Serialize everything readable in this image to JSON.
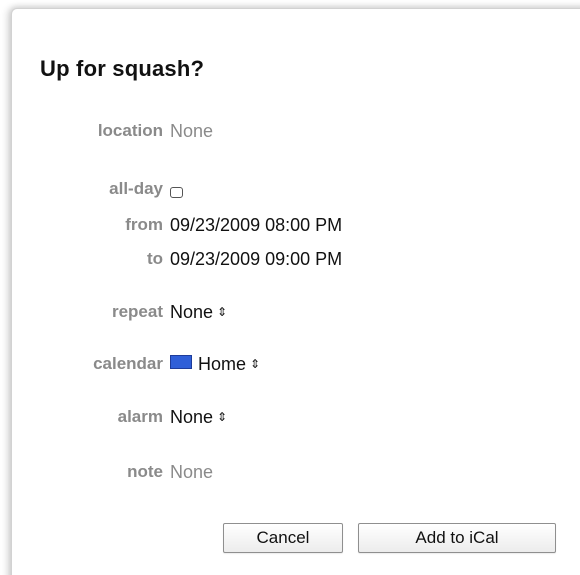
{
  "window": {
    "title": "Up for squash?"
  },
  "fields": {
    "location": {
      "label": "location",
      "value": "None"
    },
    "all_day": {
      "label": "all-day",
      "checked": false
    },
    "from": {
      "label": "from",
      "value": "09/23/2009 08:00 PM"
    },
    "to": {
      "label": "to",
      "value": "09/23/2009 09:00 PM"
    },
    "repeat": {
      "label": "repeat",
      "value": "None"
    },
    "calendar": {
      "label": "calendar",
      "value": "Home",
      "color": "#2f5fd8"
    },
    "alarm": {
      "label": "alarm",
      "value": "None"
    },
    "note": {
      "label": "note",
      "value": "None"
    }
  },
  "buttons": {
    "cancel": "Cancel",
    "add": "Add to iCal"
  },
  "icons": {
    "stepper": "up-down-arrows-icon",
    "checkbox": "checkbox-icon",
    "calendar_swatch": "calendar-color-icon"
  }
}
